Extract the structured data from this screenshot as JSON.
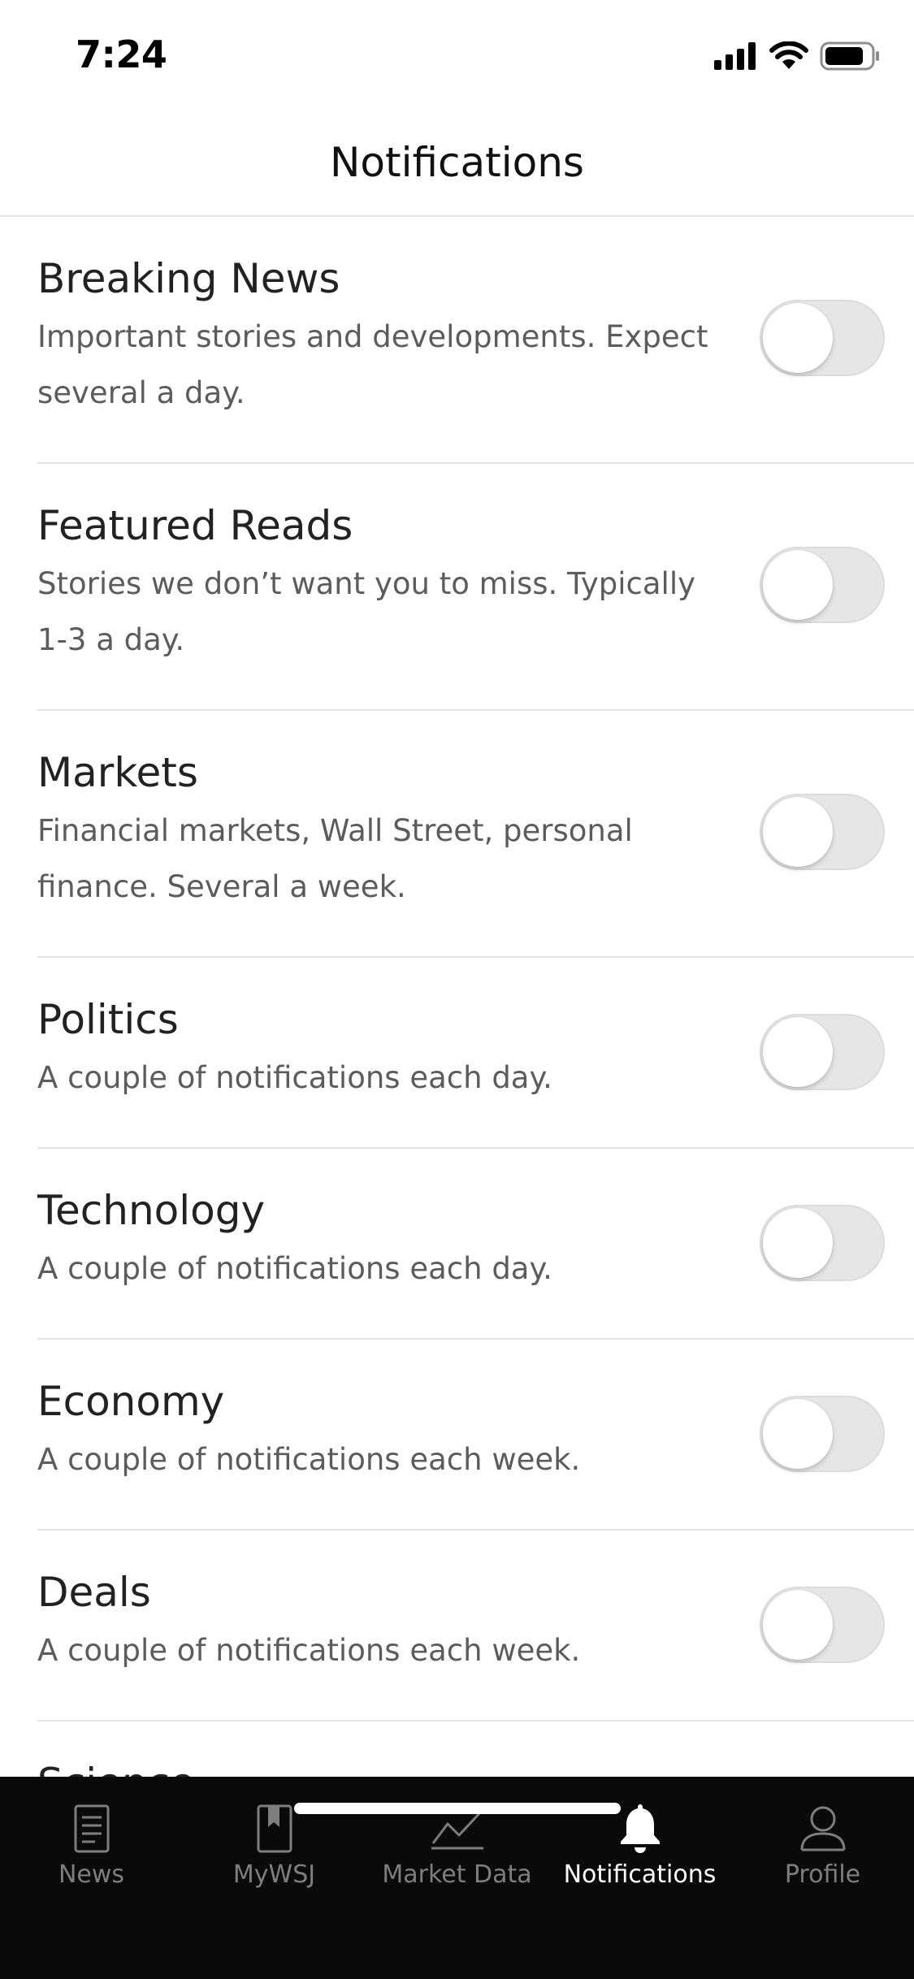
{
  "status_bar": {
    "time": "7:24",
    "icons": [
      "cellular-signal-icon",
      "wifi-icon",
      "battery-icon"
    ]
  },
  "header": {
    "title": "Notifications"
  },
  "notifications": [
    {
      "title": "Breaking News",
      "description": "Important stories and developments. Expect several a day.",
      "enabled": false
    },
    {
      "title": "Featured Reads",
      "description": "Stories we don’t want you to miss. Typically 1-3 a day.",
      "enabled": false
    },
    {
      "title": "Markets",
      "description": "Financial markets, Wall Street, personal finance. Several a week.",
      "enabled": false
    },
    {
      "title": "Politics",
      "description": "A couple of notifications each day.",
      "enabled": false
    },
    {
      "title": "Technology",
      "description": "A couple of notifications each day.",
      "enabled": false
    },
    {
      "title": "Economy",
      "description": "A couple of notifications each week.",
      "enabled": false
    },
    {
      "title": "Deals",
      "description": "A couple of notifications each week.",
      "enabled": false
    },
    {
      "title": "Science",
      "description": "",
      "enabled": false
    }
  ],
  "tabbar": {
    "tabs": [
      {
        "label": "News",
        "icon": "news-icon",
        "active": false
      },
      {
        "label": "MyWSJ",
        "icon": "bookmark-icon",
        "active": false
      },
      {
        "label": "Market Data",
        "icon": "chart-icon",
        "active": false
      },
      {
        "label": "Notifications",
        "icon": "bell-icon",
        "active": true
      },
      {
        "label": "Profile",
        "icon": "profile-icon",
        "active": false
      }
    ]
  },
  "colors": {
    "tabbar_bg": "#0a0a0a",
    "tab_active": "#ffffff",
    "tab_inactive": "#7e7e7e",
    "toggle_off": "#e6e6e6"
  }
}
